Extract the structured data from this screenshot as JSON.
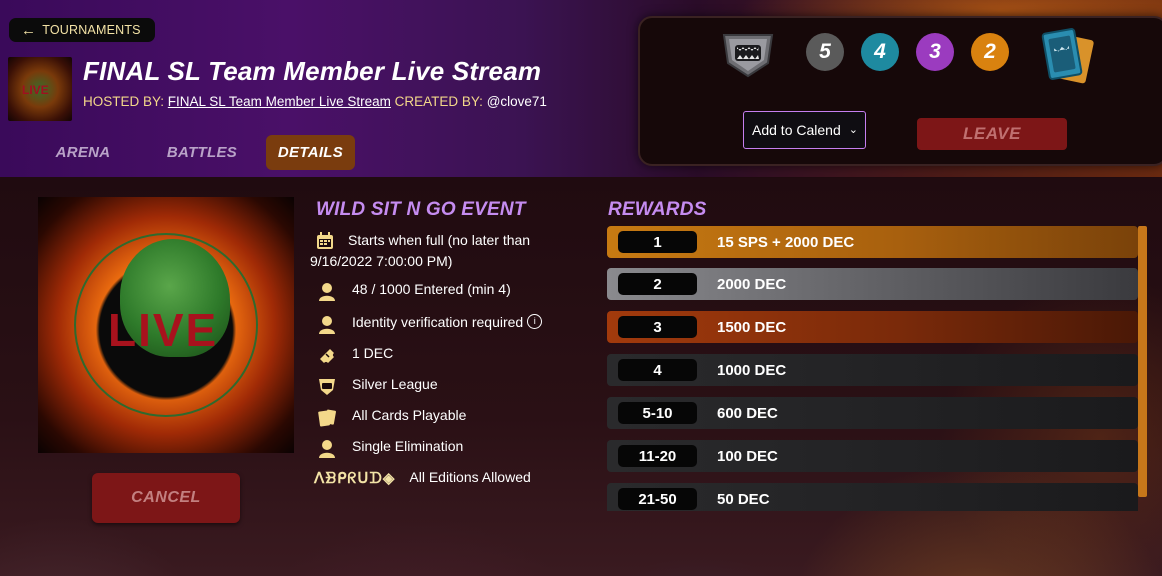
{
  "nav": {
    "back_label": "TOURNAMENTS"
  },
  "header": {
    "title": "FINAL SL Team Member Live Stream",
    "hosted_by_label": "HOSTED BY:",
    "hosted_by_link": "FINAL SL Team Member Live Stream",
    "created_by_label": "CREATED BY:",
    "created_by_user": "@clove71"
  },
  "tabs": [
    {
      "label": "ARENA",
      "active": false
    },
    {
      "label": "BATTLES",
      "active": false
    },
    {
      "label": "DETAILS",
      "active": true
    }
  ],
  "panel": {
    "league_icon": "silver-league-shield-icon",
    "counts": [
      {
        "value": "5",
        "color": "#5a5a5a"
      },
      {
        "value": "4",
        "color": "#1e8aa0"
      },
      {
        "value": "3",
        "color": "#9b3bbf"
      },
      {
        "value": "2",
        "color": "#d9820f"
      }
    ],
    "cards_icon": "card-deck-icon",
    "calendar_select": "Add to Calend",
    "leave_label": "LEAVE"
  },
  "event": {
    "art_text": "LIVE",
    "heading": "WILD SIT N GO EVENT",
    "starts": "Starts when full (no later than 9/16/2022 7:00:00 PM)",
    "entered": "48 / 1000 Entered (min 4)",
    "identity": "Identity verification required",
    "fee": "1 DEC",
    "league": "Silver League",
    "cards": "All Cards Playable",
    "format": "Single Elimination",
    "editions_runes": "ᐱᗽᑭᖇᑌᗪ◈",
    "editions": "All Editions Allowed",
    "cancel_label": "CANCEL"
  },
  "rewards": {
    "heading": "REWARDS",
    "rows": [
      {
        "rank": "1",
        "prize": "15 SPS + 2000 DEC"
      },
      {
        "rank": "2",
        "prize": "2000 DEC"
      },
      {
        "rank": "3",
        "prize": "1500 DEC"
      },
      {
        "rank": "4",
        "prize": "1000 DEC"
      },
      {
        "rank": "5-10",
        "prize": "600 DEC"
      },
      {
        "rank": "11-20",
        "prize": "100 DEC"
      },
      {
        "rank": "21-50",
        "prize": "50 DEC"
      }
    ]
  }
}
